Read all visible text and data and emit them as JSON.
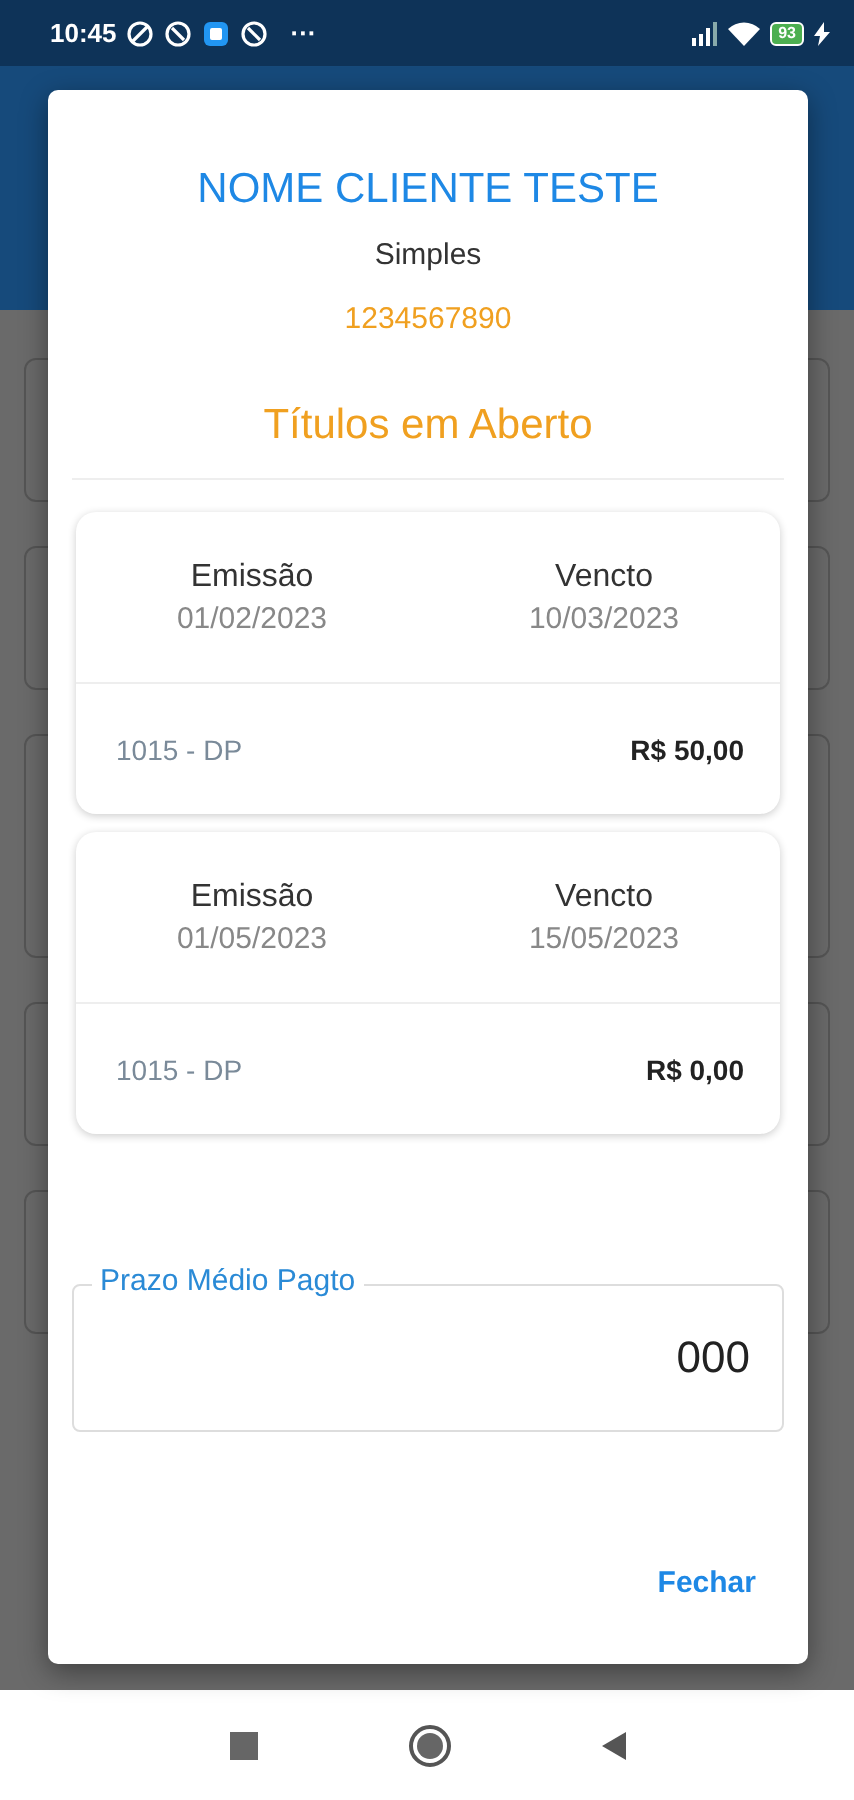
{
  "status_bar": {
    "time": "10:45",
    "more": "···",
    "battery": "93"
  },
  "dialog": {
    "client_name": "NOME CLIENTE TESTE",
    "client_type": "Simples",
    "client_code": "1234567890",
    "section_title": "Títulos em Aberto",
    "titles": [
      {
        "issue_label": "Emissão",
        "issue_date": "01/02/2023",
        "due_label": "Vencto",
        "due_date": "10/03/2023",
        "document": "1015 - DP",
        "amount": "R$ 50,00"
      },
      {
        "issue_label": "Emissão",
        "issue_date": "01/05/2023",
        "due_label": "Vencto",
        "due_date": "15/05/2023",
        "document": "1015 - DP",
        "amount": "R$ 0,00"
      }
    ],
    "field": {
      "label": "Prazo Médio Pagto",
      "value": "000"
    },
    "close_button": "Fechar"
  }
}
